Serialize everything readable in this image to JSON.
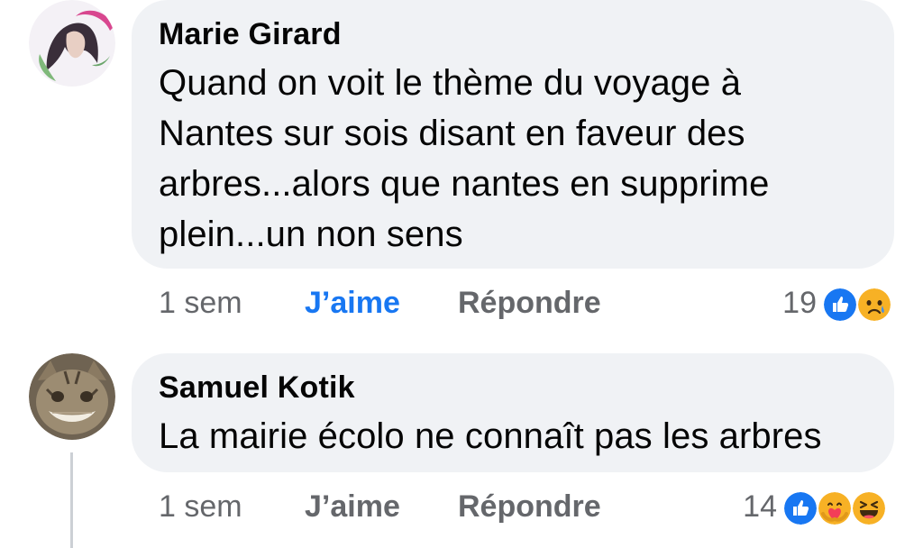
{
  "comments": [
    {
      "author": "Marie Girard",
      "lines": [
        "Quand on voit le thème du voyage à",
        "Nantes sur sois disant en faveur des",
        "arbres...alors que nantes en supprime",
        "plein...un non sens"
      ],
      "time": "1 sem",
      "like_label": "J’aime",
      "reply_label": "Répondre",
      "reaction_count": "19",
      "reactions": [
        "like-reaction-icon",
        "sad-reaction-icon"
      ],
      "liked_by_viewer": true
    },
    {
      "author": "Samuel Kotik",
      "lines": [
        "La mairie écolo ne connaît pas les arbres"
      ],
      "time": "1 sem",
      "like_label": "J’aime",
      "reply_label": "Répondre",
      "reaction_count": "14",
      "reactions": [
        "like-reaction-icon",
        "care-reaction-icon",
        "haha-reaction-icon"
      ],
      "liked_by_viewer": false
    }
  ],
  "colors": {
    "bubble": "#f0f2f5",
    "text": "#050505",
    "muted": "#65676b",
    "liked": "#1877f2"
  }
}
